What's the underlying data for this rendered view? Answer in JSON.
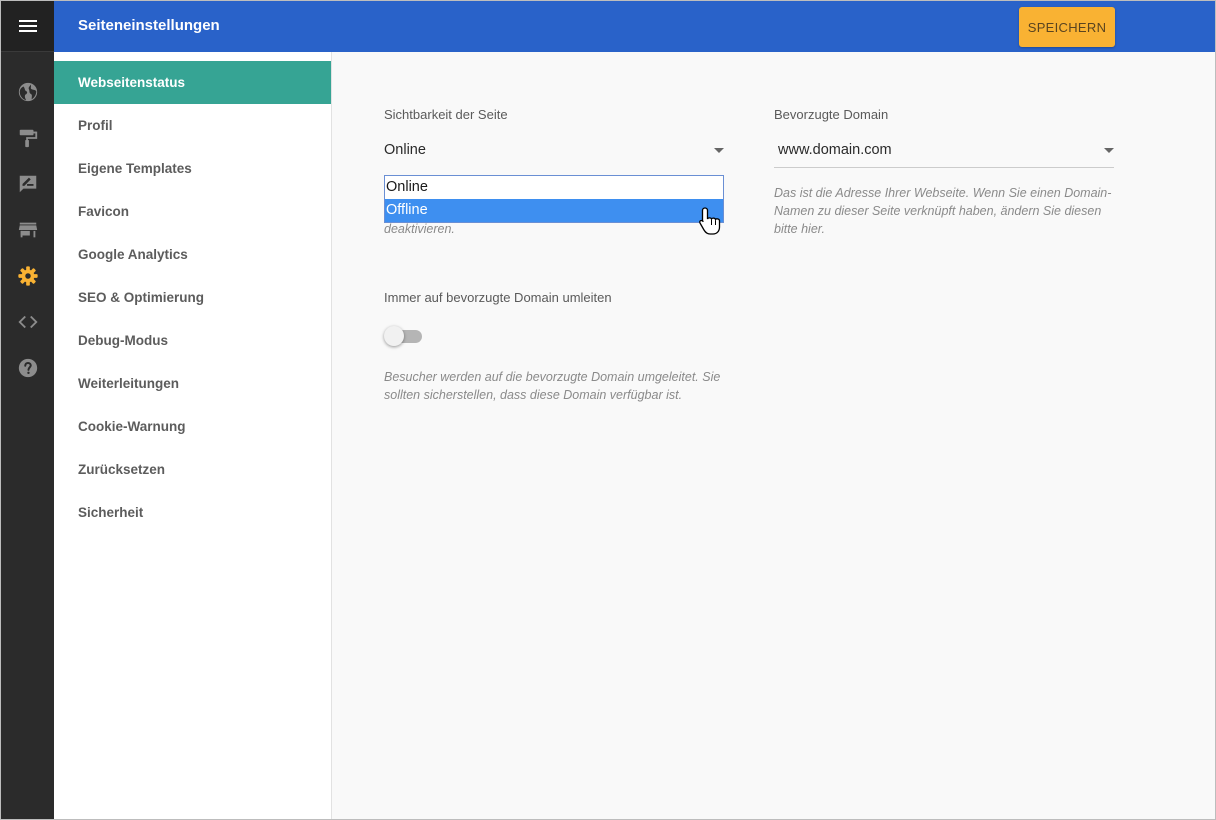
{
  "header": {
    "title": "Seiteneinstellungen",
    "save_label": "SPEICHERN",
    "bg_color": "#2962c9",
    "save_color": "#f9b233"
  },
  "rail": {
    "icons": [
      "menu-icon",
      "globe-icon",
      "paint-roller-icon",
      "edit-note-icon",
      "store-icon",
      "gear-icon",
      "code-icon",
      "help-icon"
    ],
    "active_icon": "gear-icon",
    "active_color": "#f9b233"
  },
  "sidebar": {
    "active_color": "#36a494",
    "items": [
      {
        "label": "Webseitenstatus",
        "active": true
      },
      {
        "label": "Profil"
      },
      {
        "label": "Eigene Templates"
      },
      {
        "label": "Favicon"
      },
      {
        "label": "Google Analytics"
      },
      {
        "label": "SEO & Optimierung"
      },
      {
        "label": "Debug-Modus"
      },
      {
        "label": "Weiterleitungen"
      },
      {
        "label": "Cookie-Warnung"
      },
      {
        "label": "Zurücksetzen"
      },
      {
        "label": "Sicherheit"
      }
    ]
  },
  "visibility": {
    "label": "Sichtbarkeit der Seite",
    "selected": "Online",
    "options": [
      "Online",
      "Offline"
    ],
    "highlighted": "Offline",
    "hint_visible_fragment": "deaktivieren."
  },
  "domain": {
    "label": "Bevorzugte Domain",
    "selected": "www.domain.com",
    "hint": "Das ist die Adresse Ihrer Webseite. Wenn Sie einen Domain-Namen zu dieser Seite verknüpft haben, ändern Sie diesen bitte hier."
  },
  "redirect": {
    "label": "Immer auf bevorzugte Domain umleiten",
    "enabled": false,
    "hint": "Besucher werden auf die bevorzugte Domain umgeleitet. Sie sollten sicherstellen, dass diese Domain verfügbar ist."
  }
}
